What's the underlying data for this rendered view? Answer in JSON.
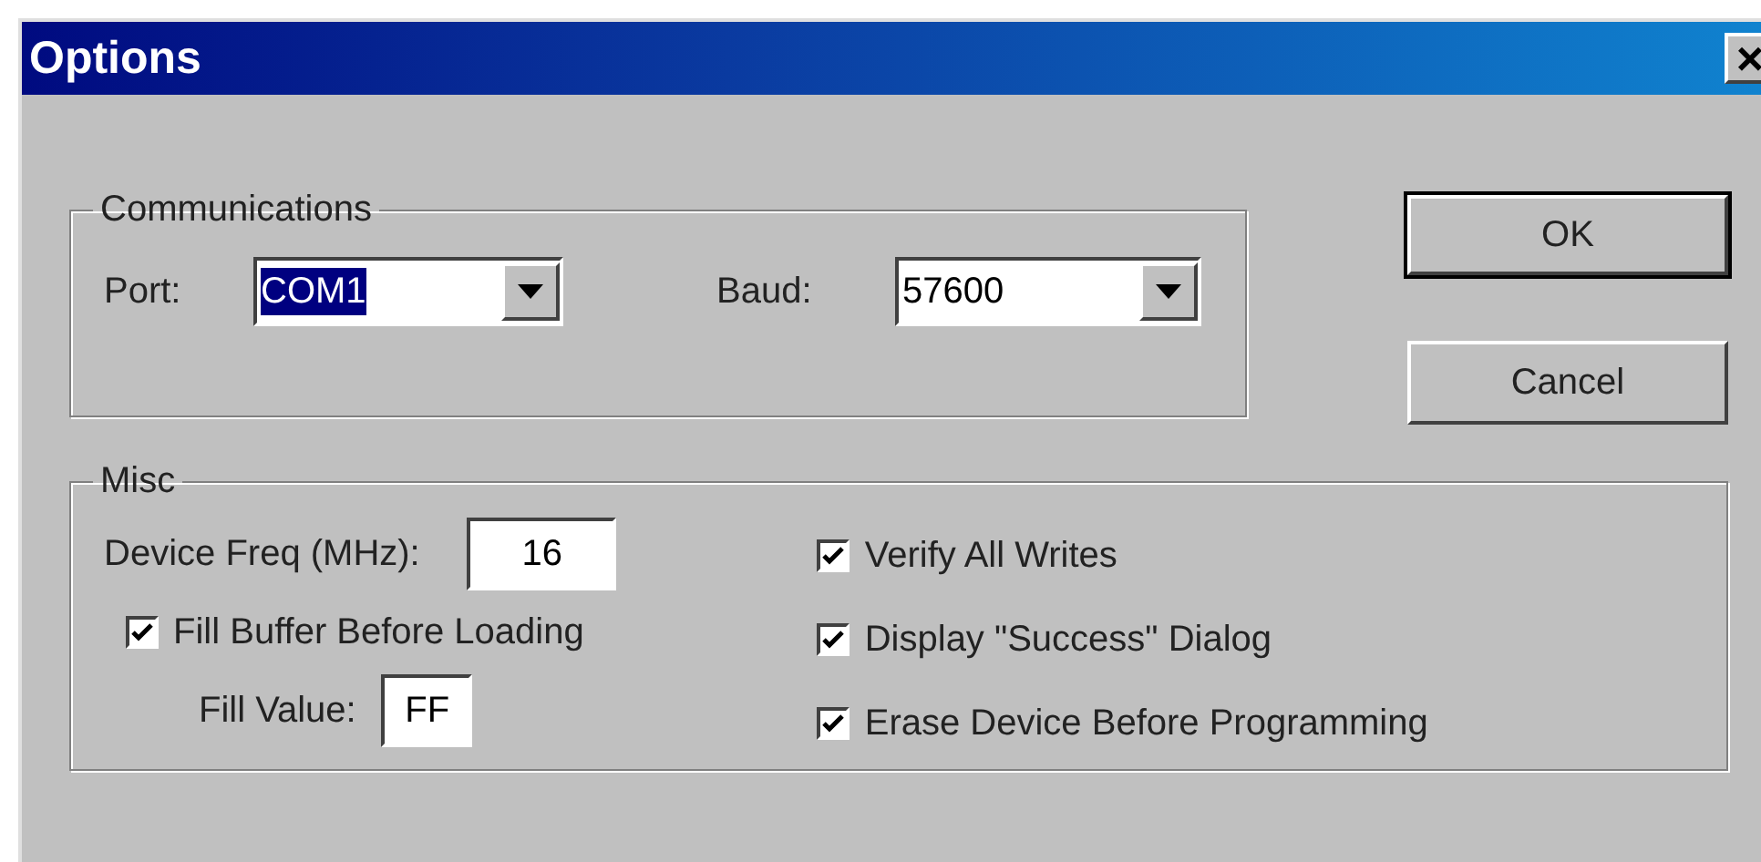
{
  "window": {
    "title": "Options",
    "close": "×"
  },
  "communications": {
    "title": "Communications",
    "port": {
      "label": "Port:",
      "value": "COM1",
      "focused": true
    },
    "baud": {
      "label": "Baud:",
      "value": "57600",
      "focused": false
    }
  },
  "buttons": [
    {
      "label": "OK",
      "default": true
    },
    {
      "label": "Cancel",
      "default": false
    }
  ],
  "misc": {
    "title": "Misc",
    "freq": {
      "label": "Device Freq (MHz):",
      "value": "16"
    },
    "fill_buffer": {
      "label": "Fill Buffer Before Loading",
      "checked": true
    },
    "fill_value": {
      "label": "Fill Value:",
      "value": "FF"
    },
    "options": [
      {
        "label": "Verify All Writes",
        "checked": true
      },
      {
        "label": "Display \"Success\" Dialog",
        "checked": true
      },
      {
        "label": "Erase Device Before Programming",
        "checked": true
      }
    ]
  }
}
